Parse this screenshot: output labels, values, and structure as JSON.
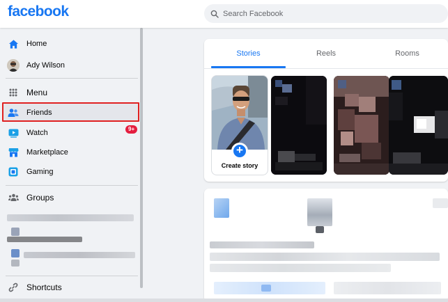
{
  "header": {
    "logo": "facebook",
    "search": {
      "placeholder": "Search Facebook",
      "value": ""
    }
  },
  "sidebar": {
    "items": [
      {
        "label": "Home",
        "icon": "home-icon"
      },
      {
        "label": "Ady Wilson",
        "icon": "profile-avatar"
      },
      {
        "label": "Menu",
        "icon": "menu-grid-icon"
      },
      {
        "label": "Friends",
        "icon": "friends-icon"
      },
      {
        "label": "Watch",
        "icon": "watch-icon",
        "badge": "9+"
      },
      {
        "label": "Marketplace",
        "icon": "marketplace-icon"
      },
      {
        "label": "Gaming",
        "icon": "gaming-icon"
      }
    ],
    "groups_label": "Groups",
    "shortcuts_label": "Shortcuts"
  },
  "stories": {
    "tabs": [
      {
        "label": "Stories",
        "active": true
      },
      {
        "label": "Reels",
        "active": false
      },
      {
        "label": "Rooms",
        "active": false
      }
    ],
    "create_story_label": "Create story"
  },
  "colors": {
    "brand": "#1877f2",
    "badge": "#e41e3f",
    "highlight": "#e02020",
    "background": "#f0f2f5"
  }
}
